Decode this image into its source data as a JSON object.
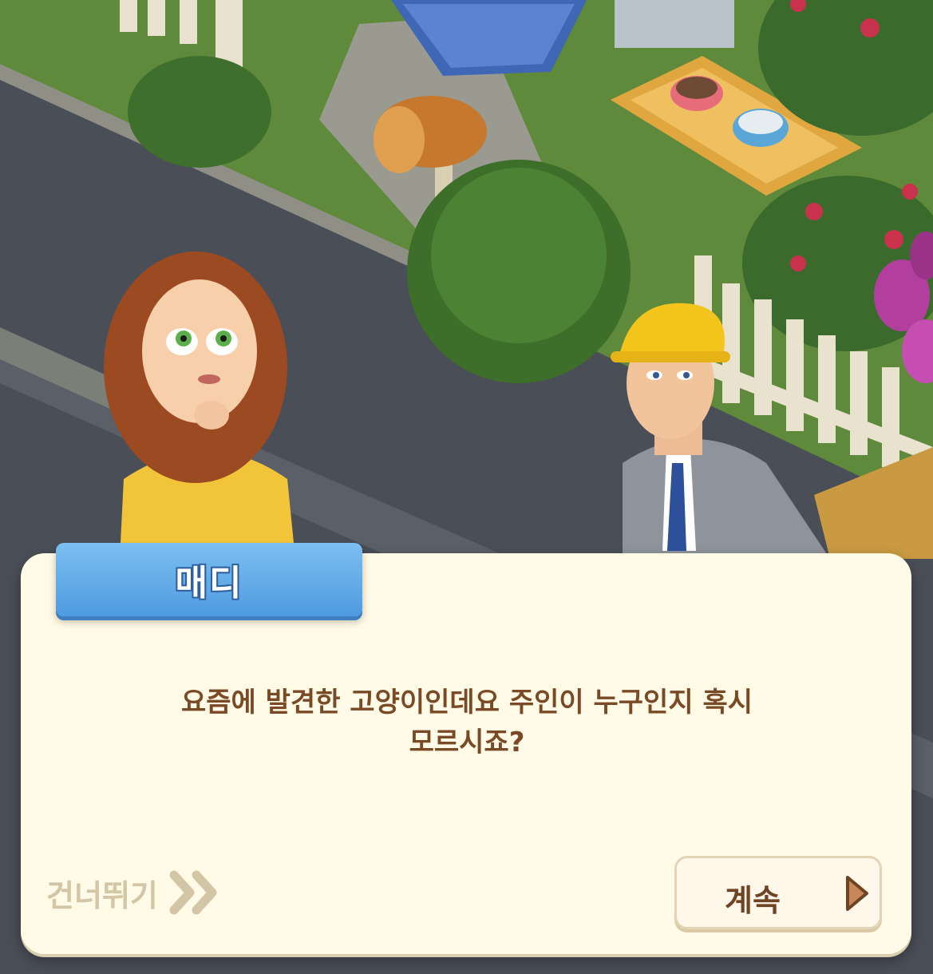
{
  "dialog": {
    "speaker_name": "매디",
    "message_line1": "요즘에 발견한 고양이인데요 주인이 누구인지 혹시",
    "message_line2": "모르시죠?"
  },
  "controls": {
    "skip_label": "건너뛰기",
    "continue_label": "계속"
  },
  "icons": {
    "skip": "double-chevron-right-icon",
    "continue": "play-triangle-icon"
  },
  "colors": {
    "dialog_bg": "#fffbe6",
    "name_tab": "#5aa8e8",
    "message_text": "#7a4a26",
    "skip_text": "#d4c5a6",
    "continue_arrow": "#c8875a"
  }
}
